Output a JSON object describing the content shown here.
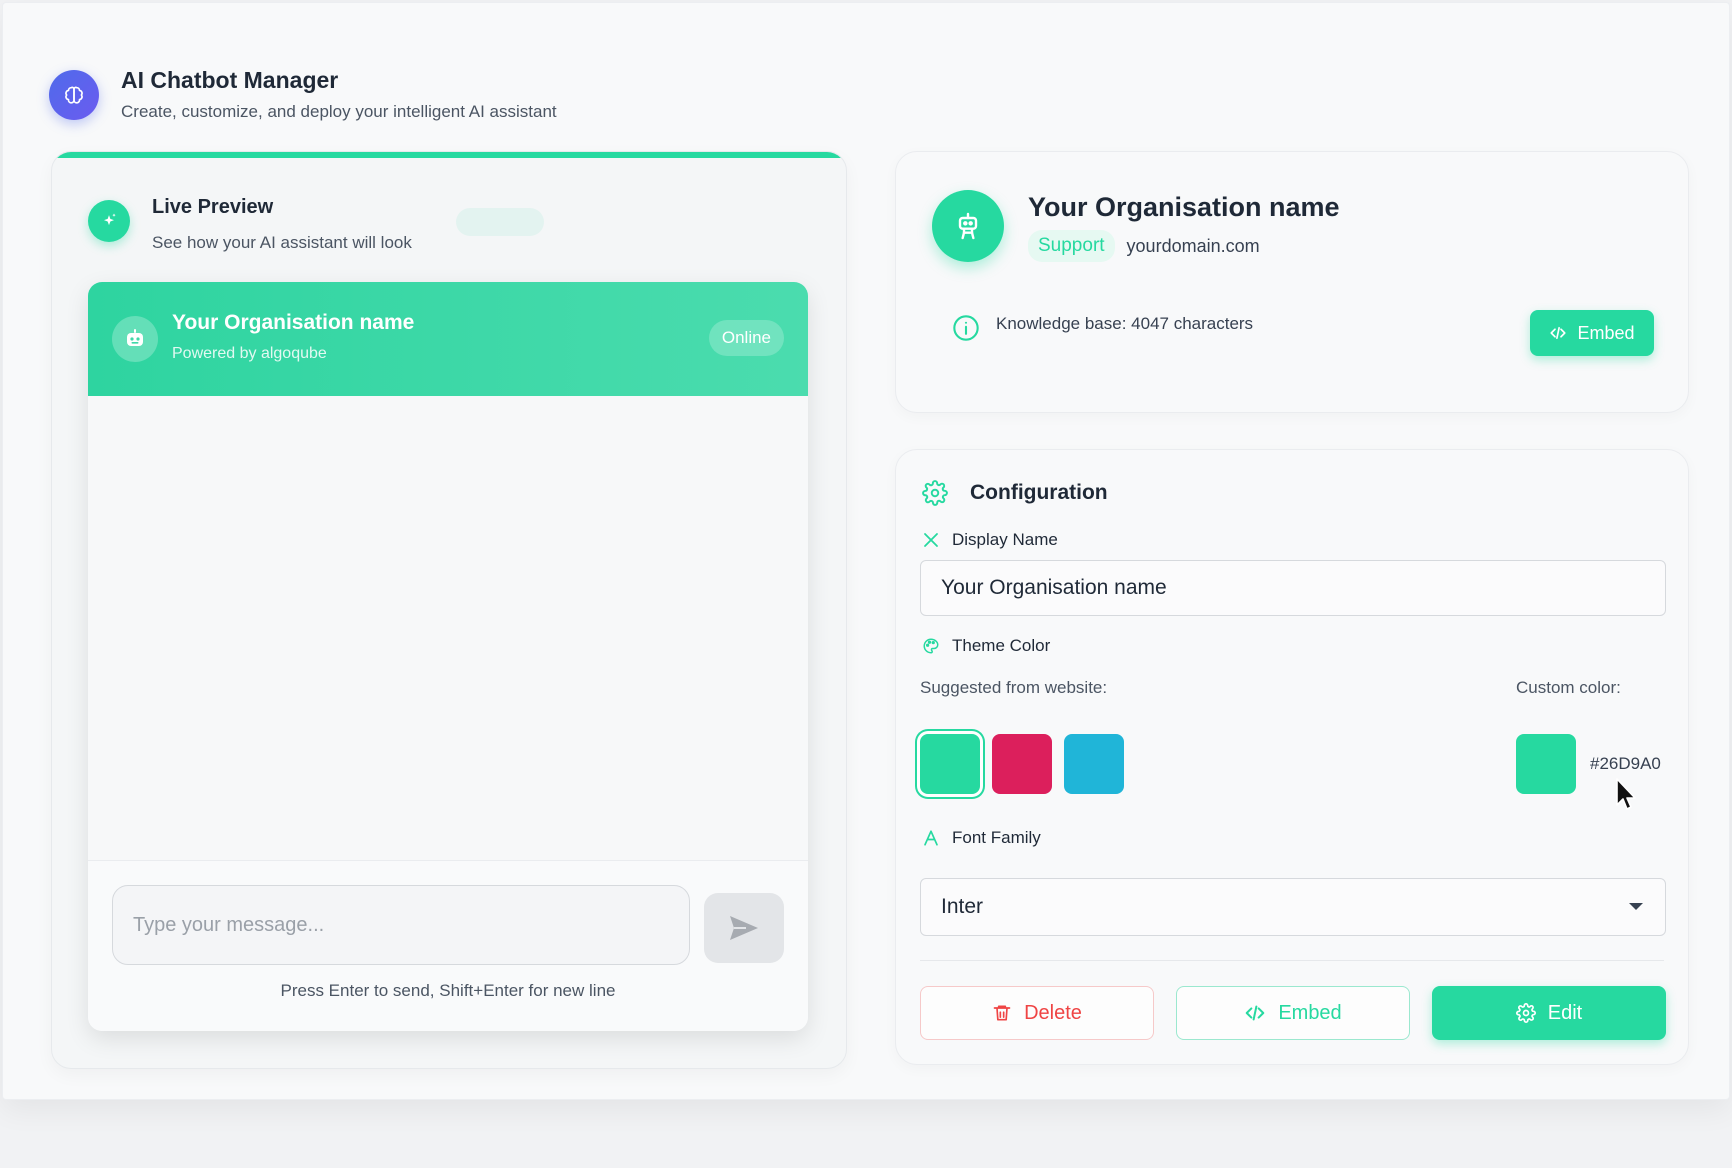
{
  "header": {
    "icon": "brain-icon",
    "title": "AI Chatbot Manager",
    "subtitle": "Create, customize, and deploy your intelligent AI assistant"
  },
  "preview": {
    "icon": "sparkles-icon",
    "title": "Live Preview",
    "subtitle": "See how your AI assistant will look",
    "chat": {
      "bot_icon": "robot-icon",
      "name": "Your Organisation name",
      "powered_by": "Powered by algoqube",
      "status": "Online",
      "input_placeholder": "Type your message...",
      "send_icon": "send-icon",
      "hint": "Press Enter to send, Shift+Enter for new line"
    }
  },
  "org": {
    "icon": "robot-icon",
    "name": "Your Organisation name",
    "badge": "Support",
    "domain": "yourdomain.com",
    "knowledge_base": "Knowledge base: 4047 characters",
    "embed_label": "Embed"
  },
  "config": {
    "title": "Configuration",
    "display_name": {
      "label": "Display Name",
      "value": "Your Organisation name"
    },
    "theme": {
      "label": "Theme Color",
      "suggested_label": "Suggested from website:",
      "suggested": [
        "#26D9A0",
        "#DC1F5C",
        "#20B5D8"
      ],
      "selected_index": 0,
      "custom_label": "Custom color:",
      "custom_value": "#26D9A0"
    },
    "font": {
      "label": "Font Family",
      "value": "Inter"
    },
    "buttons": {
      "delete": "Delete",
      "embed": "Embed",
      "edit": "Edit"
    }
  },
  "colors": {
    "accent": "#26D9A0",
    "brand_logo": "#5063EA",
    "danger": "#EF4444"
  }
}
